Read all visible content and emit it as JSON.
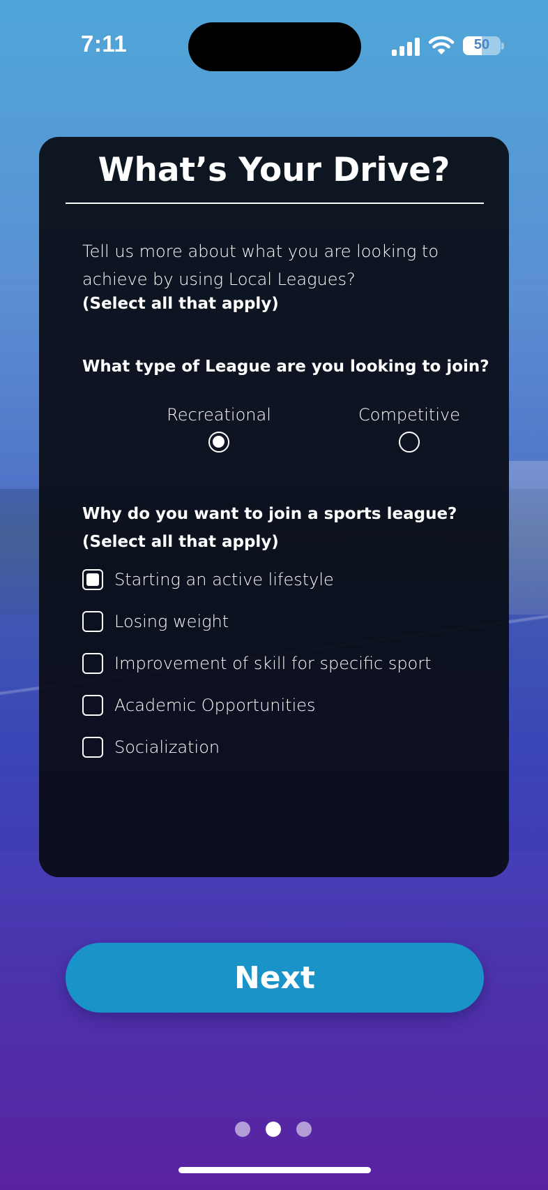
{
  "status_bar": {
    "time": "7:11",
    "battery": "50",
    "battery_level": 0.5,
    "icons": [
      "signal-icon",
      "wifi-icon",
      "battery-icon"
    ]
  },
  "card": {
    "title": "What’s Your Drive?",
    "intro": "Tell us more about what you are looking to achieve by using Local Leagues?",
    "intro_note": "(Select all that apply)",
    "league_question": "What type of League are you looking to join?",
    "league_options": [
      {
        "label": "Recreational",
        "selected": true
      },
      {
        "label": "Competitive",
        "selected": false
      }
    ],
    "reason_question": "Why do you want to join a sports league?",
    "reason_note": "(Select all that apply)",
    "reasons": [
      {
        "label": "Starting an active lifestyle",
        "checked": true
      },
      {
        "label": "Losing weight",
        "checked": false
      },
      {
        "label": "Improvement of skill for specific sport",
        "checked": false
      },
      {
        "label": "Academic Opportunities",
        "checked": false
      },
      {
        "label": "Socialization",
        "checked": false
      }
    ]
  },
  "next_button": {
    "label": "Next"
  },
  "pagination": {
    "count": 3,
    "active": 2
  },
  "colors": {
    "accent": "#1a93c9",
    "card_background": "#090c14",
    "text": "#ffffff"
  }
}
